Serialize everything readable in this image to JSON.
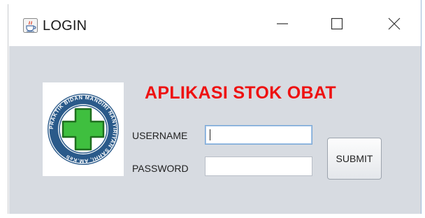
{
  "window": {
    "title": "LOGIN",
    "app_icon": "java-coffee-cup-icon",
    "controls": {
      "minimize_icon": "minimize-icon",
      "maximize_icon": "maximize-icon",
      "close_icon": "close-icon"
    }
  },
  "main": {
    "heading": "APLIKASI STOK OBAT",
    "heading_color": "#ee1111",
    "logo": {
      "ring_text": "PRAKTIK BIDAN MANDIRI NANYIRIYAN SAHHI, AM.Keb",
      "ring_color": "#2a5a8a",
      "cross_color": "#3fbf3f"
    },
    "form": {
      "username_label": "USERNAME",
      "username_value": "",
      "password_label": "PASSWORD",
      "password_value": "",
      "submit_label": "SUBMIT"
    }
  },
  "colors": {
    "content_background": "#d7dbe1",
    "titlebar_background": "#ffffff"
  }
}
